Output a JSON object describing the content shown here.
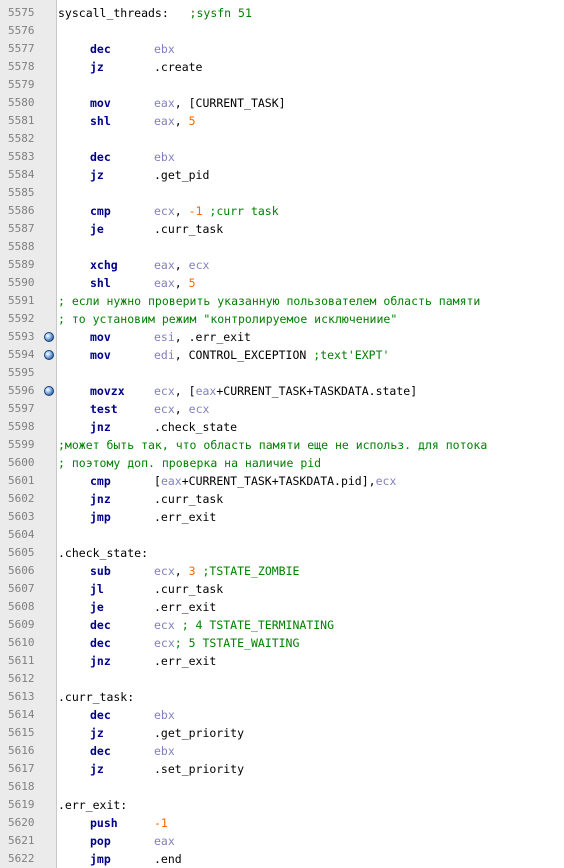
{
  "colors": {
    "keyword": "#00008b",
    "register": "#8080c0",
    "number": "#ff6600",
    "comment": "#008000",
    "gutter": "#ebebeb",
    "breakpoint": "#2a5fa8"
  },
  "lines": [
    {
      "n": "5575",
      "label": "syscall_threads:",
      "tokens": [
        {
          "t": "cmt",
          "v": "   ;sysfn 51"
        }
      ]
    },
    {
      "n": "5576",
      "tokens": []
    },
    {
      "n": "5577",
      "op": "dec",
      "tokens": [
        {
          "t": "reg",
          "v": "ebx"
        }
      ]
    },
    {
      "n": "5578",
      "op": "jz",
      "tokens": [
        {
          "t": "plain",
          "v": ".create"
        }
      ]
    },
    {
      "n": "5579",
      "tokens": []
    },
    {
      "n": "5580",
      "op": "mov",
      "tokens": [
        {
          "t": "reg",
          "v": "eax"
        },
        {
          "t": "plain",
          "v": ", [CURRENT_TASK]"
        }
      ]
    },
    {
      "n": "5581",
      "op": "shl",
      "tokens": [
        {
          "t": "reg",
          "v": "eax"
        },
        {
          "t": "plain",
          "v": ", "
        },
        {
          "t": "num",
          "v": "5"
        }
      ]
    },
    {
      "n": "5582",
      "tokens": []
    },
    {
      "n": "5583",
      "op": "dec",
      "tokens": [
        {
          "t": "reg",
          "v": "ebx"
        }
      ]
    },
    {
      "n": "5584",
      "op": "jz",
      "tokens": [
        {
          "t": "plain",
          "v": ".get_pid"
        }
      ]
    },
    {
      "n": "5585",
      "tokens": []
    },
    {
      "n": "5586",
      "op": "cmp",
      "tokens": [
        {
          "t": "reg",
          "v": "ecx"
        },
        {
          "t": "plain",
          "v": ", "
        },
        {
          "t": "num",
          "v": "-1"
        },
        {
          "t": "cmt",
          "v": " ;curr task"
        }
      ]
    },
    {
      "n": "5587",
      "op": "je",
      "tokens": [
        {
          "t": "plain",
          "v": ".curr_task"
        }
      ]
    },
    {
      "n": "5588",
      "tokens": []
    },
    {
      "n": "5589",
      "op": "xchg",
      "tokens": [
        {
          "t": "reg",
          "v": "eax"
        },
        {
          "t": "plain",
          "v": ", "
        },
        {
          "t": "reg",
          "v": "ecx"
        }
      ]
    },
    {
      "n": "5590",
      "op": "shl",
      "tokens": [
        {
          "t": "reg",
          "v": "eax"
        },
        {
          "t": "plain",
          "v": ", "
        },
        {
          "t": "num",
          "v": "5"
        }
      ]
    },
    {
      "n": "5591",
      "comment": "; если нужно проверить указанную пользователем область памяти"
    },
    {
      "n": "5592",
      "comment": "; то установим режим \"контролируемое исключениие\""
    },
    {
      "n": "5593",
      "bp": true,
      "op": "mov",
      "tokens": [
        {
          "t": "reg",
          "v": "esi"
        },
        {
          "t": "plain",
          "v": ", .err_exit"
        }
      ]
    },
    {
      "n": "5594",
      "bp": true,
      "op": "mov",
      "tokens": [
        {
          "t": "reg",
          "v": "edi"
        },
        {
          "t": "plain",
          "v": ", CONTROL_EXCEPTION "
        },
        {
          "t": "cmt",
          "v": ";text'EXPT'"
        }
      ]
    },
    {
      "n": "5595",
      "tokens": []
    },
    {
      "n": "5596",
      "bp": true,
      "op": "movzx",
      "tokens": [
        {
          "t": "reg",
          "v": "ecx"
        },
        {
          "t": "plain",
          "v": ", ["
        },
        {
          "t": "reg",
          "v": "eax"
        },
        {
          "t": "plain",
          "v": "+CURRENT_TASK+TASKDATA.state]"
        }
      ]
    },
    {
      "n": "5597",
      "op": "test",
      "tokens": [
        {
          "t": "reg",
          "v": "ecx"
        },
        {
          "t": "plain",
          "v": ", "
        },
        {
          "t": "reg",
          "v": "ecx"
        }
      ]
    },
    {
      "n": "5598",
      "op": "jnz",
      "tokens": [
        {
          "t": "plain",
          "v": ".check_state"
        }
      ]
    },
    {
      "n": "5599",
      "comment": ";может быть так, что область памяти еще не использ. для потока"
    },
    {
      "n": "5600",
      "comment": "; поэтому доп. проверка на наличие pid"
    },
    {
      "n": "5601",
      "op": "cmp",
      "tokens": [
        {
          "t": "plain",
          "v": "["
        },
        {
          "t": "reg",
          "v": "eax"
        },
        {
          "t": "plain",
          "v": "+CURRENT_TASK+TASKDATA.pid],"
        },
        {
          "t": "reg",
          "v": "ecx"
        }
      ]
    },
    {
      "n": "5602",
      "op": "jnz",
      "tokens": [
        {
          "t": "plain",
          "v": ".curr_task"
        }
      ]
    },
    {
      "n": "5603",
      "op": "jmp",
      "tokens": [
        {
          "t": "plain",
          "v": ".err_exit"
        }
      ]
    },
    {
      "n": "5604",
      "tokens": []
    },
    {
      "n": "5605",
      "label": ".check_state:",
      "tokens": []
    },
    {
      "n": "5606",
      "op": "sub",
      "tokens": [
        {
          "t": "reg",
          "v": "ecx"
        },
        {
          "t": "plain",
          "v": ", "
        },
        {
          "t": "num",
          "v": "3"
        },
        {
          "t": "cmt",
          "v": " ;TSTATE_ZOMBIE"
        }
      ]
    },
    {
      "n": "5607",
      "op": "jl",
      "tokens": [
        {
          "t": "plain",
          "v": ".curr_task"
        }
      ]
    },
    {
      "n": "5608",
      "op": "je",
      "tokens": [
        {
          "t": "plain",
          "v": ".err_exit"
        }
      ]
    },
    {
      "n": "5609",
      "op": "dec",
      "tokens": [
        {
          "t": "reg",
          "v": "ecx"
        },
        {
          "t": "cmt",
          "v": " ; 4 TSTATE_TERMINATING"
        }
      ]
    },
    {
      "n": "5610",
      "op": "dec",
      "tokens": [
        {
          "t": "reg",
          "v": "ecx"
        },
        {
          "t": "cmt",
          "v": "; 5 TSTATE_WAITING"
        }
      ]
    },
    {
      "n": "5611",
      "op": "jnz",
      "tokens": [
        {
          "t": "plain",
          "v": ".err_exit"
        }
      ]
    },
    {
      "n": "5612",
      "tokens": []
    },
    {
      "n": "5613",
      "label": ".curr_task:",
      "tokens": []
    },
    {
      "n": "5614",
      "op": "dec",
      "tokens": [
        {
          "t": "reg",
          "v": "ebx"
        }
      ]
    },
    {
      "n": "5615",
      "op": "jz",
      "tokens": [
        {
          "t": "plain",
          "v": ".get_priority"
        }
      ]
    },
    {
      "n": "5616",
      "op": "dec",
      "tokens": [
        {
          "t": "reg",
          "v": "ebx"
        }
      ]
    },
    {
      "n": "5617",
      "op": "jz",
      "tokens": [
        {
          "t": "plain",
          "v": ".set_priority"
        }
      ]
    },
    {
      "n": "5618",
      "tokens": []
    },
    {
      "n": "5619",
      "label": ".err_exit:",
      "tokens": []
    },
    {
      "n": "5620",
      "op": "push",
      "tokens": [
        {
          "t": "num",
          "v": "-1"
        }
      ]
    },
    {
      "n": "5621",
      "op": "pop",
      "tokens": [
        {
          "t": "reg",
          "v": "eax"
        }
      ]
    },
    {
      "n": "5622",
      "op": "jmp",
      "tokens": [
        {
          "t": "plain",
          "v": ".end"
        }
      ]
    }
  ]
}
